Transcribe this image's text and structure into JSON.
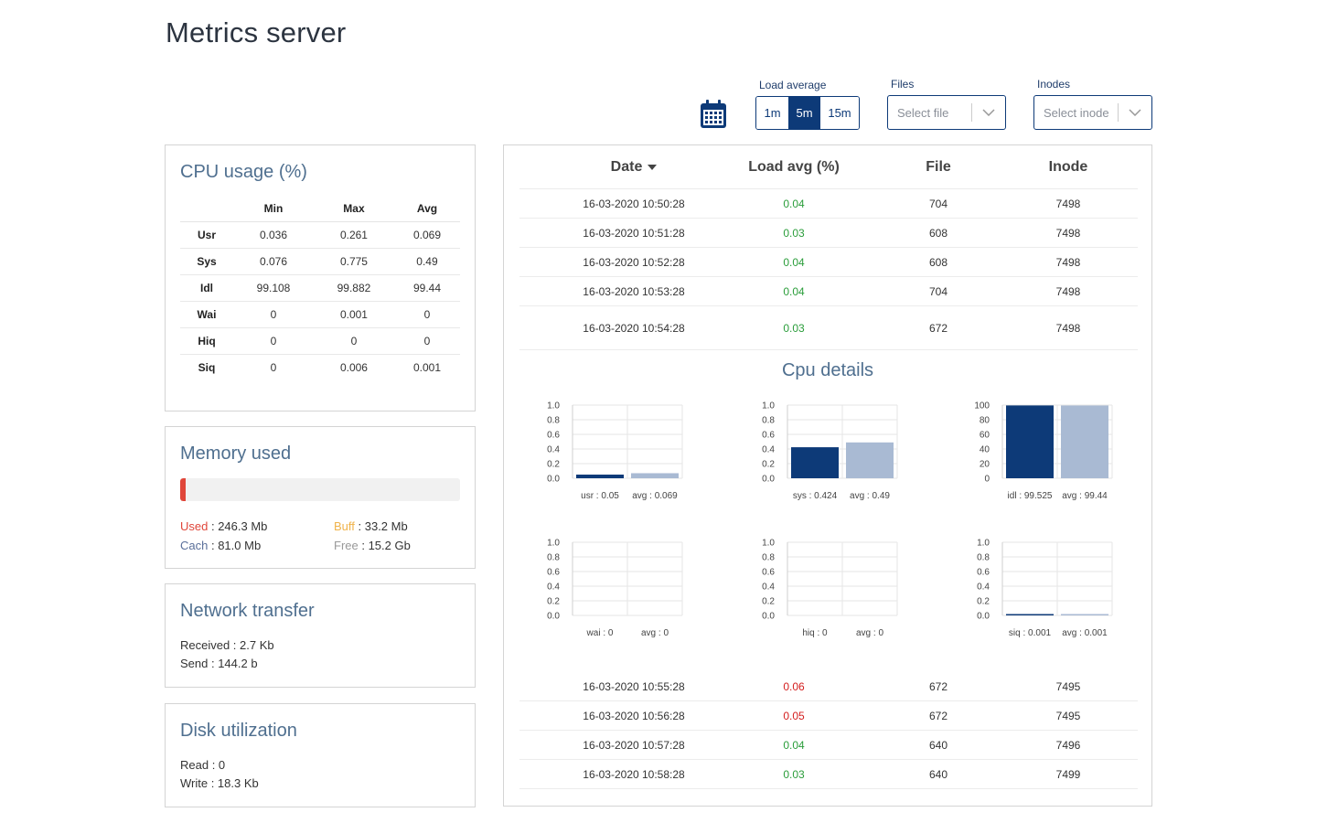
{
  "page": {
    "title": "Metrics server"
  },
  "controls": {
    "load_average": {
      "label": "Load average",
      "options": [
        "1m",
        "5m",
        "15m"
      ],
      "selected": "5m"
    },
    "files": {
      "label": "Files",
      "placeholder": "Select file"
    },
    "inodes": {
      "label": "Inodes",
      "placeholder": "Select inode"
    }
  },
  "cpu_usage": {
    "title": "CPU usage (%)",
    "columns": [
      "Min",
      "Max",
      "Avg"
    ],
    "rows": [
      {
        "name": "Usr",
        "min": "0.036",
        "max": "0.261",
        "avg": "0.069"
      },
      {
        "name": "Sys",
        "min": "0.076",
        "max": "0.775",
        "avg": "0.49"
      },
      {
        "name": "Idl",
        "min": "99.108",
        "max": "99.882",
        "avg": "99.44"
      },
      {
        "name": "Wai",
        "min": "0",
        "max": "0.001",
        "avg": "0"
      },
      {
        "name": "Hiq",
        "min": "0",
        "max": "0",
        "avg": "0"
      },
      {
        "name": "Siq",
        "min": "0",
        "max": "0.006",
        "avg": "0.001"
      }
    ]
  },
  "memory": {
    "title": "Memory used",
    "used_fraction": 0.02,
    "used_label": "Used",
    "used_value": "246.3 Mb",
    "buff_label": "Buff",
    "buff_value": "33.2 Mb",
    "cach_label": "Cach",
    "cach_value": "81.0 Mb",
    "free_label": "Free",
    "free_value": "15.2 Gb",
    "colors": {
      "used": "#e0463a",
      "buff": "#f0b34a",
      "cach": "#5a6f9a",
      "free": "#999999"
    }
  },
  "network": {
    "title": "Network transfer",
    "received": "Received : 2.7 Kb",
    "send": "Send : 144.2 b"
  },
  "disk": {
    "title": "Disk utilization",
    "read": "Read : 0",
    "write": "Write : 18.3 Kb"
  },
  "table": {
    "headers": {
      "date": "Date",
      "load": "Load avg (%)",
      "file": "File",
      "inode": "Inode"
    },
    "rows_top": [
      {
        "date": "16-03-2020 10:50:28",
        "load": "0.04",
        "status": "ok",
        "file": "704",
        "inode": "7498"
      },
      {
        "date": "16-03-2020 10:51:28",
        "load": "0.03",
        "status": "ok",
        "file": "608",
        "inode": "7498"
      },
      {
        "date": "16-03-2020 10:52:28",
        "load": "0.04",
        "status": "ok",
        "file": "608",
        "inode": "7498"
      },
      {
        "date": "16-03-2020 10:53:28",
        "load": "0.04",
        "status": "ok",
        "file": "704",
        "inode": "7498"
      },
      {
        "date": "16-03-2020 10:54:28",
        "load": "0.03",
        "status": "ok",
        "file": "672",
        "inode": "7498"
      }
    ],
    "rows_bottom": [
      {
        "date": "16-03-2020 10:55:28",
        "load": "0.06",
        "status": "high",
        "file": "672",
        "inode": "7495"
      },
      {
        "date": "16-03-2020 10:56:28",
        "load": "0.05",
        "status": "high",
        "file": "672",
        "inode": "7495"
      },
      {
        "date": "16-03-2020 10:57:28",
        "load": "0.04",
        "status": "ok",
        "file": "640",
        "inode": "7496"
      },
      {
        "date": "16-03-2020 10:58:28",
        "load": "0.03",
        "status": "ok",
        "file": "640",
        "inode": "7499"
      }
    ]
  },
  "cpu_details": {
    "title": "Cpu details",
    "colors": {
      "current": "#0d3a78",
      "avg": "#a9bad3",
      "ok": "#2a9d3a",
      "high": "#d42020"
    },
    "charts": [
      {
        "ticks": [
          "1.0",
          "0.8",
          "0.6",
          "0.4",
          "0.2",
          "0.0"
        ],
        "ymax": 1,
        "bars": [
          {
            "label": "usr : 0.05",
            "value": 0.05
          },
          {
            "label": "avg : 0.069",
            "value": 0.069
          }
        ],
        "grid": "4x2"
      },
      {
        "ticks": [
          "1.0",
          "0.8",
          "0.6",
          "0.4",
          "0.2",
          "0.0"
        ],
        "ymax": 1,
        "bars": [
          {
            "label": "sys : 0.424",
            "value": 0.424
          },
          {
            "label": "avg : 0.49",
            "value": 0.49
          }
        ],
        "grid": "4x2"
      },
      {
        "ticks": [
          "100",
          "80",
          "60",
          "40",
          "20",
          "0"
        ],
        "ymax": 100,
        "bars": [
          {
            "label": "idl : 99.525",
            "value": 99.525
          },
          {
            "label": "avg : 99.44",
            "value": 99.44
          }
        ],
        "grid": "4x2"
      },
      {
        "ticks": [
          "1.0",
          "0.8",
          "0.6",
          "0.4",
          "0.2",
          "0.0"
        ],
        "ymax": 1,
        "bars": [
          {
            "label": "wai : 0",
            "value": 0
          },
          {
            "label": "avg : 0",
            "value": 0
          }
        ],
        "grid": "4x2"
      },
      {
        "ticks": [
          "1.0",
          "0.8",
          "0.6",
          "0.4",
          "0.2",
          "0.0"
        ],
        "ymax": 1,
        "bars": [
          {
            "label": "hiq : 0",
            "value": 0
          },
          {
            "label": "avg : 0",
            "value": 0
          }
        ],
        "grid": "4x2"
      },
      {
        "ticks": [
          "1.0",
          "0.8",
          "0.6",
          "0.4",
          "0.2",
          "0.0"
        ],
        "ymax": 1,
        "bars": [
          {
            "label": "siq : 0.001",
            "value": 0.001
          },
          {
            "label": "avg : 0.001",
            "value": 0.001
          }
        ],
        "grid": "4x2"
      }
    ]
  }
}
